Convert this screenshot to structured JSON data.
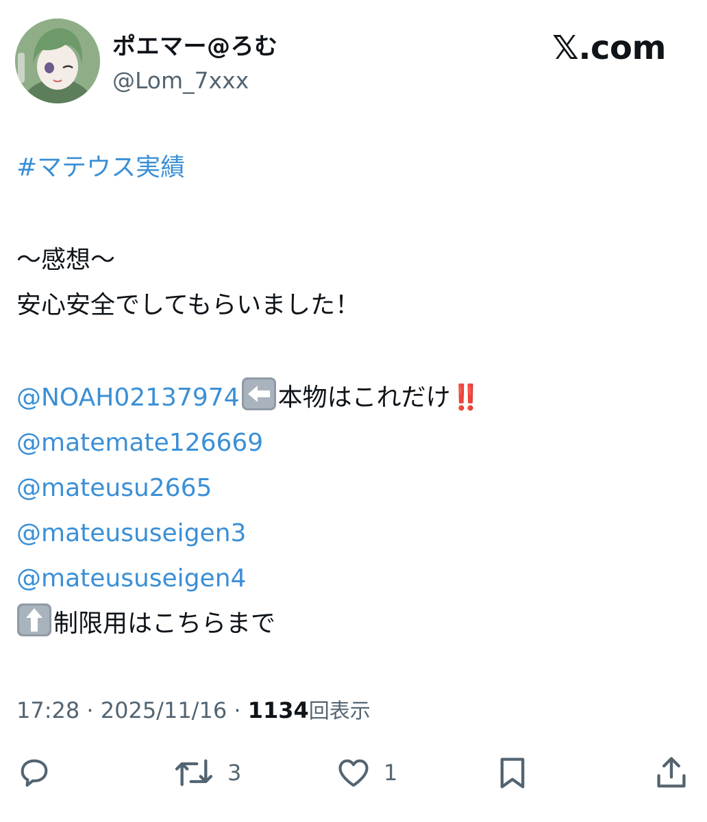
{
  "author": {
    "display_name": "ポエマー@ろむ",
    "handle": "@Lom_7xxx",
    "avatar_icon": "avatar-anime-character"
  },
  "brand": "𝕏.com",
  "post": {
    "hashtag": "#マテウス実績",
    "lines": {
      "impression_heading": "〜感想〜",
      "impression_text": "安心安全でしてもらいました！",
      "mention_1": "@NOAH02137974",
      "mention_1_note": "本物はこれだけ",
      "mention_1_mark": "‼️",
      "mention_2": "@matemate126669",
      "mention_3": "@mateusu2665",
      "mention_4": "@mateususeigen3",
      "mention_5": "@mateususeigen4",
      "closing_text": "制限用はこちらまで"
    },
    "link_color": "#3a8fd6"
  },
  "meta": {
    "time": "17:28",
    "separator": "·",
    "date": "2025/11/16",
    "views": "1134",
    "views_label": "回表示"
  },
  "actions": {
    "reply_icon": "speech-bubble-icon",
    "retweet_icon": "retweet-icon",
    "retweet_count": "3",
    "like_icon": "heart-icon",
    "like_count": "1",
    "bookmark_icon": "bookmark-icon",
    "share_icon": "share-icon"
  }
}
